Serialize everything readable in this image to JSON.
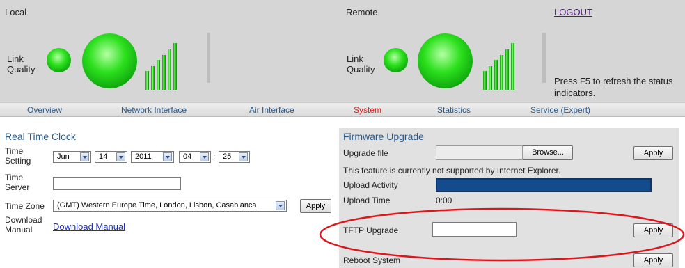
{
  "status": {
    "local": {
      "title": "Local",
      "link_quality_label": "Link\nQuality",
      "signal_bars": 5
    },
    "remote": {
      "title": "Remote",
      "link_quality_label": "Link\nQuality",
      "signal_bars": 5
    },
    "logout": "LOGOUT",
    "refresh_note": "Press F5 to refresh the status indicators."
  },
  "nav": {
    "tabs": [
      {
        "label": "Overview"
      },
      {
        "label": "Network Interface"
      },
      {
        "label": "Air Interface"
      },
      {
        "label": "System",
        "active": true
      },
      {
        "label": "Statistics"
      },
      {
        "label": "Service (Expert)"
      }
    ]
  },
  "rtc": {
    "title": "Real Time Clock",
    "time_setting_label": "Time\nSetting",
    "month": "Jun",
    "day": "14",
    "year": "2011",
    "hour": "04",
    "separator": ":",
    "minute": "25",
    "time_server_label": "Time\nServer",
    "time_server_value": "",
    "time_zone_label": "Time Zone",
    "time_zone_value": "(GMT) Western Europe Time, London, Lisbon, Casablanca",
    "apply": "Apply",
    "download_label": "Download\nManual",
    "download_link": "Download Manual"
  },
  "firmware": {
    "title": "Firmware Upgrade",
    "upgrade_file_label": "Upgrade file",
    "browse": "Browse...",
    "apply": "Apply",
    "ie_note": "This feature is currently not supported by Internet Explorer.",
    "upload_activity_label": "Upload Activity",
    "upload_progress": 1.0,
    "upload_time_label": "Upload Time",
    "upload_time_value": "0:00",
    "tftp_label": "TFTP Upgrade",
    "tftp_apply": "Apply",
    "reboot_label": "Reboot System",
    "reboot_apply": "Apply"
  },
  "colors": {
    "accent_link": "#2a5a8a",
    "active_tab": "#e01b1b",
    "progress_fill": "#134b8c",
    "highlight_ellipse": "#e0151b"
  }
}
